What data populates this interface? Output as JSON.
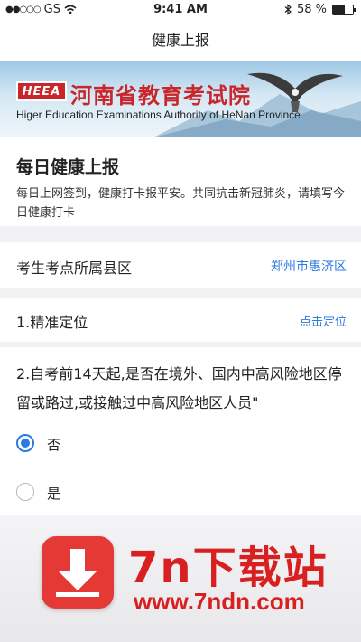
{
  "status_bar": {
    "carrier": "GS",
    "time": "9:41 AM",
    "battery_text": "58 %",
    "battery_level": 0.58
  },
  "nav": {
    "title": "健康上报"
  },
  "banner": {
    "logo_text": "HEEA",
    "title": "河南省教育考试院",
    "subtitle": "Higer Education Examinations Authority of HeNan Province"
  },
  "intro": {
    "title": "每日健康上报",
    "description": "每日上网签到，健康打卡报平安。共同抗击新冠肺炎，请填写今日健康打卡"
  },
  "county": {
    "label": "考生考点所属县区",
    "value": "郑州市惠济区"
  },
  "location": {
    "label": "1.精准定位",
    "action": "点击定位"
  },
  "question2": {
    "text": "2.自考前14天起,是否在境外、国内中高风险地区停留或路过,或接触过中高风险地区人员\"",
    "options": [
      {
        "label": "否",
        "selected": true
      },
      {
        "label": "是",
        "selected": false
      }
    ]
  },
  "watermark": {
    "name": "7n下载站",
    "url": "www.7ndn.com"
  },
  "colors": {
    "accent": "#2a7ae2",
    "brand_red": "#c8262b",
    "watermark_red": "#d82020"
  }
}
